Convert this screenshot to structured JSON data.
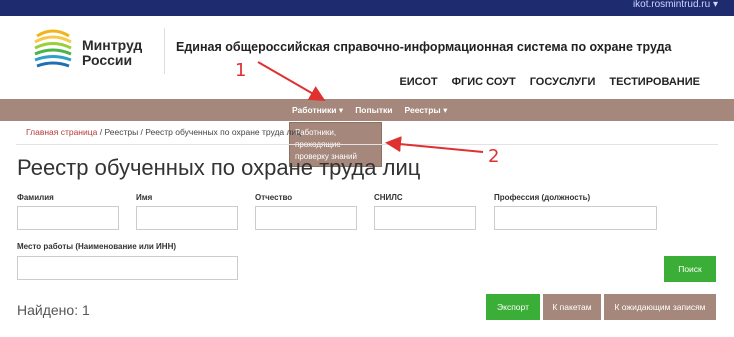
{
  "topbar": {
    "user": "ikot.rosmintrud.ru ▾"
  },
  "header": {
    "logo_text_line1": "Минтруд",
    "logo_text_line2": "России",
    "system_title": "Единая общероссийская справочно-информационная система по охране труда",
    "links": [
      "ЕИСОТ",
      "ФГИС СОУТ",
      "ГОСУСЛУГИ",
      "ТЕСТИРОВАНИЕ"
    ]
  },
  "nav": {
    "workers": "Работники",
    "attempts": "Попытки",
    "registries": "Реестры",
    "caret": "▾"
  },
  "dropdown": {
    "line1": "Работники,",
    "line2": "проходящие",
    "line3": "проверку знаний"
  },
  "breadcrumb": {
    "home": "Главная страница",
    "rest": " / Реестры / Реестр обученных по охране труда лиц"
  },
  "page": {
    "title": "Реестр обученных по охране труда лиц"
  },
  "form": {
    "surname_label": "Фамилия",
    "name_label": "Имя",
    "patronymic_label": "Отчество",
    "snils_label": "СНИЛС",
    "profession_label": "Профессия (должность)",
    "workplace_label": "Место работы (Наименование или ИНН)",
    "search_button": "Поиск"
  },
  "results": {
    "found": "Найдено: 1",
    "export_button": "Экспорт",
    "packages_button": "К пакетам",
    "pending_button": "К ожидающим записям"
  },
  "annotations": {
    "num1": "1",
    "num2": "2",
    "color": "#e03131"
  }
}
